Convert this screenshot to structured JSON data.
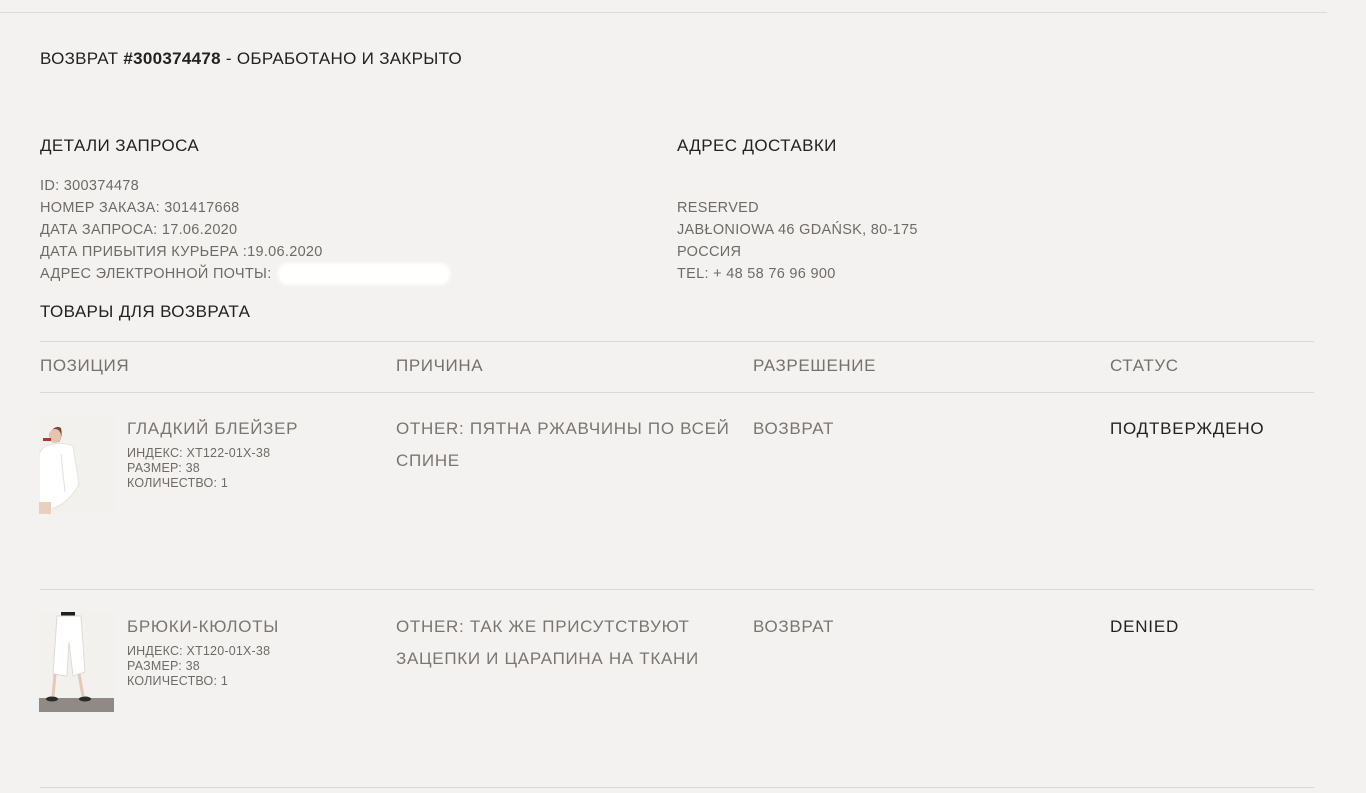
{
  "page": {
    "title_prefix": "ВОЗВРАТ ",
    "title_number": "#300374478",
    "title_suffix": " - ОБРАБОТАНО И ЗАКРЫТО"
  },
  "request_details": {
    "heading": "ДЕТАЛИ ЗАПРОСА",
    "id": "ID: 300374478",
    "order_number": "НОМЕР ЗАКАЗА: 301417668",
    "request_date": "ДАТА ЗАПРОСА: 17.06.2020",
    "courier_date": "ДАТА ПРИБЫТИЯ КУРЬЕРА :19.06.2020",
    "email_label": "АДРЕС ЭЛЕКТРОННОЙ ПОЧТЫ:"
  },
  "delivery_address": {
    "heading": "АДРЕС ДОСТАВКИ",
    "name": "RESERVED",
    "street": "JABŁONIOWA 46 GDAŃSK, 80-175",
    "country": "РОССИЯ",
    "phone": "TEL: + 48 58 76 96 900"
  },
  "items_section": {
    "heading": "ТОВАРЫ ДЛЯ ВОЗВРАТА",
    "columns": [
      "ПОЗИЦИЯ",
      "ПРИЧИНА",
      "РАЗРЕШЕНИЕ",
      "СТАТУС"
    ]
  },
  "items": [
    {
      "name": "ГЛАДКИЙ БЛЕЙЗЕР",
      "index": "ИНДЕКС: XT122-01X-38",
      "size": "РАЗМЕР: 38",
      "quantity": "КОЛИЧЕСТВО: 1",
      "reason": "OTHER: ПЯТНА РЖАВЧИНЫ ПО ВСЕЙ СПИНЕ",
      "resolution": "ВОЗВРАТ",
      "status": "ПОДТВЕРЖДЕНО"
    },
    {
      "name": "БРЮКИ-КЮЛОТЫ",
      "index": "ИНДЕКС: XT120-01X-38",
      "size": "РАЗМЕР: 38",
      "quantity": "КОЛИЧЕСТВО: 1",
      "reason": "OTHER: ТАК ЖЕ ПРИСУТСТВУЮТ ЗАЦЕПКИ И ЦАРАПИНА НА ТКАНИ",
      "resolution": "ВОЗВРАТ",
      "status": "DENIED"
    }
  ]
}
